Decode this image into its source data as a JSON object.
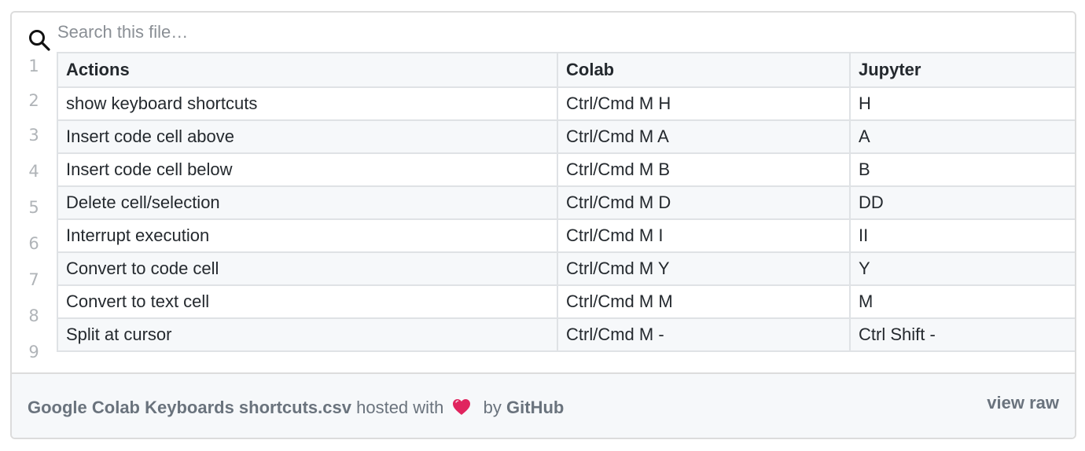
{
  "search": {
    "placeholder": "Search this file…",
    "value": ""
  },
  "table": {
    "headers": [
      "Actions",
      "Colab",
      "Jupyter"
    ],
    "rows": [
      [
        "show keyboard shortcuts",
        "Ctrl/Cmd M H",
        "H"
      ],
      [
        "Insert code cell above",
        "Ctrl/Cmd M A",
        "A"
      ],
      [
        "Insert code cell below",
        "Ctrl/Cmd M B",
        "B"
      ],
      [
        "Delete cell/selection",
        "Ctrl/Cmd M D",
        "DD"
      ],
      [
        "Interrupt execution",
        "Ctrl/Cmd M I",
        "II"
      ],
      [
        "Convert to code cell",
        "Ctrl/Cmd M Y",
        "Y"
      ],
      [
        "Convert to text cell",
        "Ctrl/Cmd M M",
        "M"
      ],
      [
        "Split at cursor",
        "Ctrl/Cmd M -",
        "Ctrl Shift -"
      ]
    ]
  },
  "gutter": {
    "line_numbers": [
      "1",
      "2",
      "3",
      "4",
      "5",
      "6",
      "7",
      "8",
      "9"
    ]
  },
  "footer": {
    "file_name": "Google Colab Keyboards shortcuts.csv",
    "hosted_with": "hosted with",
    "by": "by",
    "host": "GitHub",
    "view_raw": "view raw"
  },
  "icons": {
    "search": "search-icon",
    "heart": "heart-icon"
  },
  "colors": {
    "heart": "#e0245e",
    "border": "#dfe2e5",
    "header_bg": "#f6f8fa",
    "muted_text": "#6a737d"
  }
}
